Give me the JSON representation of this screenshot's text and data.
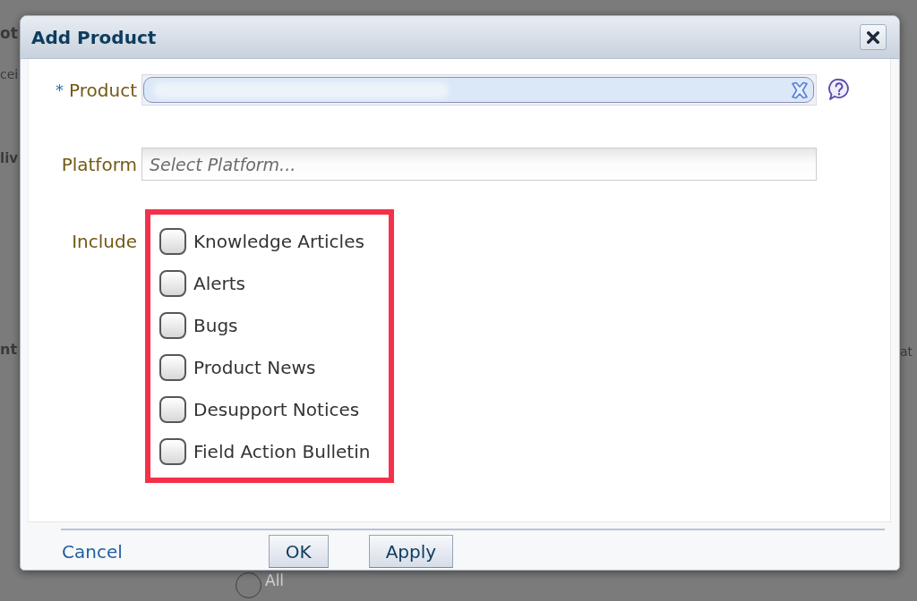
{
  "background": {
    "left_fragments": [
      {
        "text": "ot",
        "kind": "heading"
      },
      {
        "text": "cei",
        "kind": "text"
      },
      {
        "text": "liv",
        "kind": "heading"
      },
      {
        "text": "nt",
        "kind": "heading"
      }
    ],
    "right_fragments": [
      {
        "text": "at"
      }
    ],
    "radio": {
      "label": "All",
      "selected": false
    }
  },
  "dialog": {
    "title": "Add Product",
    "product": {
      "label": "Product",
      "required_mark": "*",
      "redacted": true
    },
    "platform": {
      "label": "Platform",
      "placeholder": "Select Platform..."
    },
    "include": {
      "label": "Include",
      "highlighted": true,
      "options": [
        {
          "label": "Knowledge Articles",
          "checked": false
        },
        {
          "label": "Alerts",
          "checked": false
        },
        {
          "label": "Bugs",
          "checked": false
        },
        {
          "label": "Product News",
          "checked": false
        },
        {
          "label": "Desupport Notices",
          "checked": false
        },
        {
          "label": "Field Action Bulletin",
          "checked": false
        }
      ]
    },
    "footer": {
      "actions": [
        {
          "kind": "link",
          "label": "Cancel"
        },
        {
          "kind": "button",
          "label": "OK"
        },
        {
          "kind": "button",
          "label": "Apply"
        }
      ]
    }
  }
}
